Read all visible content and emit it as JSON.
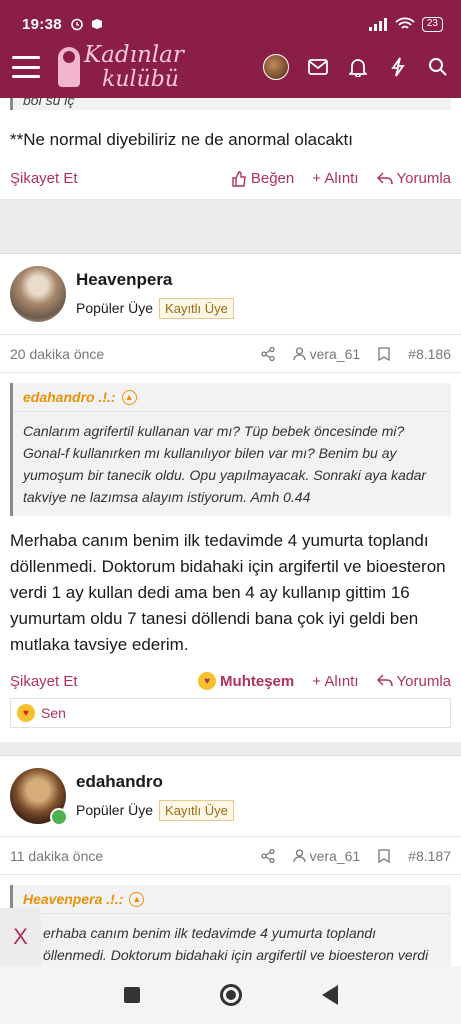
{
  "status": {
    "time": "19:38",
    "battery": "23"
  },
  "header": {
    "logo_line1": "Kadınlar",
    "logo_line2": "kulübü"
  },
  "top_post": {
    "quote_tail": "bol su iç",
    "body": "**Ne normal diyebiliriz ne de anormal olacaktı",
    "report": "Şikayet Et",
    "like": "Beğen",
    "quote": "+ Alıntı",
    "reply": "Yorumla"
  },
  "post1": {
    "username": "Heavenpera",
    "role": "Popüler Üye",
    "badge": "Kayıtlı Üye",
    "time": "20 dakika önce",
    "quote_user": "vera_61",
    "post_no": "#8.186",
    "quote_author": "edahandro .!.:",
    "quote_text": "Canlarım agrifertil kullanan var mı? Tüp bebek öncesinde mi? Gonal-f kullanırken mı kullanılıyor bilen var mı? Benim bu ay yumoşum bir tanecik oldu. Opu yapılmayacak. Sonraki aya kadar takviye ne lazımsa alayım istiyorum. Amh 0.44",
    "body": "Merhaba canım benim ilk tedavimde 4 yumurta toplandı döllenmedi. Doktorum bidahaki için argifertil ve bioesteron verdi 1 ay kullan dedi ama ben 4 ay kullanıp gittim 16 yumurtam oldu 7 tanesi döllendi bana çok iyi geldi ben mutlaka tavsiye ederim.",
    "report": "Şikayet Et",
    "reaction": "Muhteşem",
    "quote": "+ Alıntı",
    "reply": "Yorumla",
    "reacted_by": "Sen"
  },
  "post2": {
    "username": "edahandro",
    "role": "Popüler Üye",
    "badge": "Kayıtlı Üye",
    "time": "11 dakika önce",
    "quote_user": "vera_61",
    "post_no": "#8.187",
    "quote_author": "Heavenpera .!.:",
    "quote_text": "erhaba canım benim ilk tedavimde 4 yumurta toplandı\nöllenmedi. Doktorum bidahaki için argifertil ve bioesteron verdi"
  },
  "float_close": "X",
  "colors": {
    "brand": "#8b1e47",
    "accent": "#b03060",
    "quote_author": "#e8920c"
  }
}
